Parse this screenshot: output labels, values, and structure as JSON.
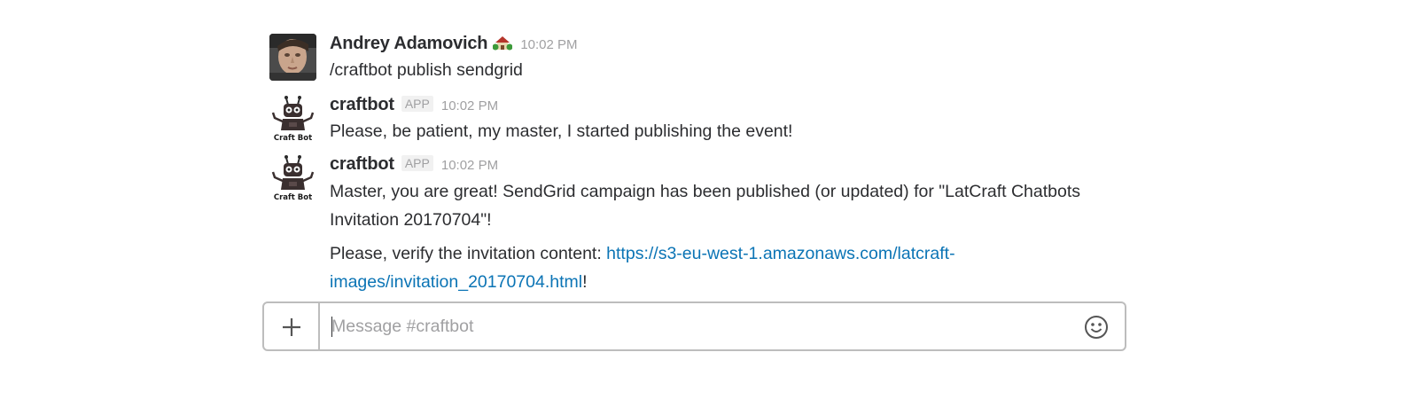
{
  "messages": [
    {
      "sender": "Andrey Adamovich",
      "badge": "",
      "time": "10:02 PM",
      "lines": [
        "/craftbot publish sendgrid"
      ]
    },
    {
      "sender": "craftbot",
      "badge": "APP",
      "time": "10:02 PM",
      "lines": [
        "Please, be patient, my master, I started publishing the event!"
      ]
    },
    {
      "sender": "craftbot",
      "badge": "APP",
      "time": "10:02 PM",
      "paragraph1": "Master, you are great! SendGrid campaign has been published (or updated) for \"LatCraft Chatbots Invitation 20170704\"!",
      "paragraph2_prefix": "Please, verify the invitation content: ",
      "paragraph2_link": "https://s3-eu-west-1.amazonaws.com/latcraft-images/invitation_20170704.html",
      "paragraph2_suffix": "!"
    }
  ],
  "avatars": {
    "bot_caption": "Craft Bot"
  },
  "composer": {
    "placeholder": "Message #craftbot",
    "plus_icon": "plus-icon",
    "emoji_icon": "smiley-icon"
  },
  "icons": {
    "status_emoji": "house-with-garden-icon"
  },
  "colors": {
    "link": "#0b74b5",
    "muted": "#a0a0a2",
    "text": "#2c2d30",
    "border": "#bdbdbd"
  }
}
